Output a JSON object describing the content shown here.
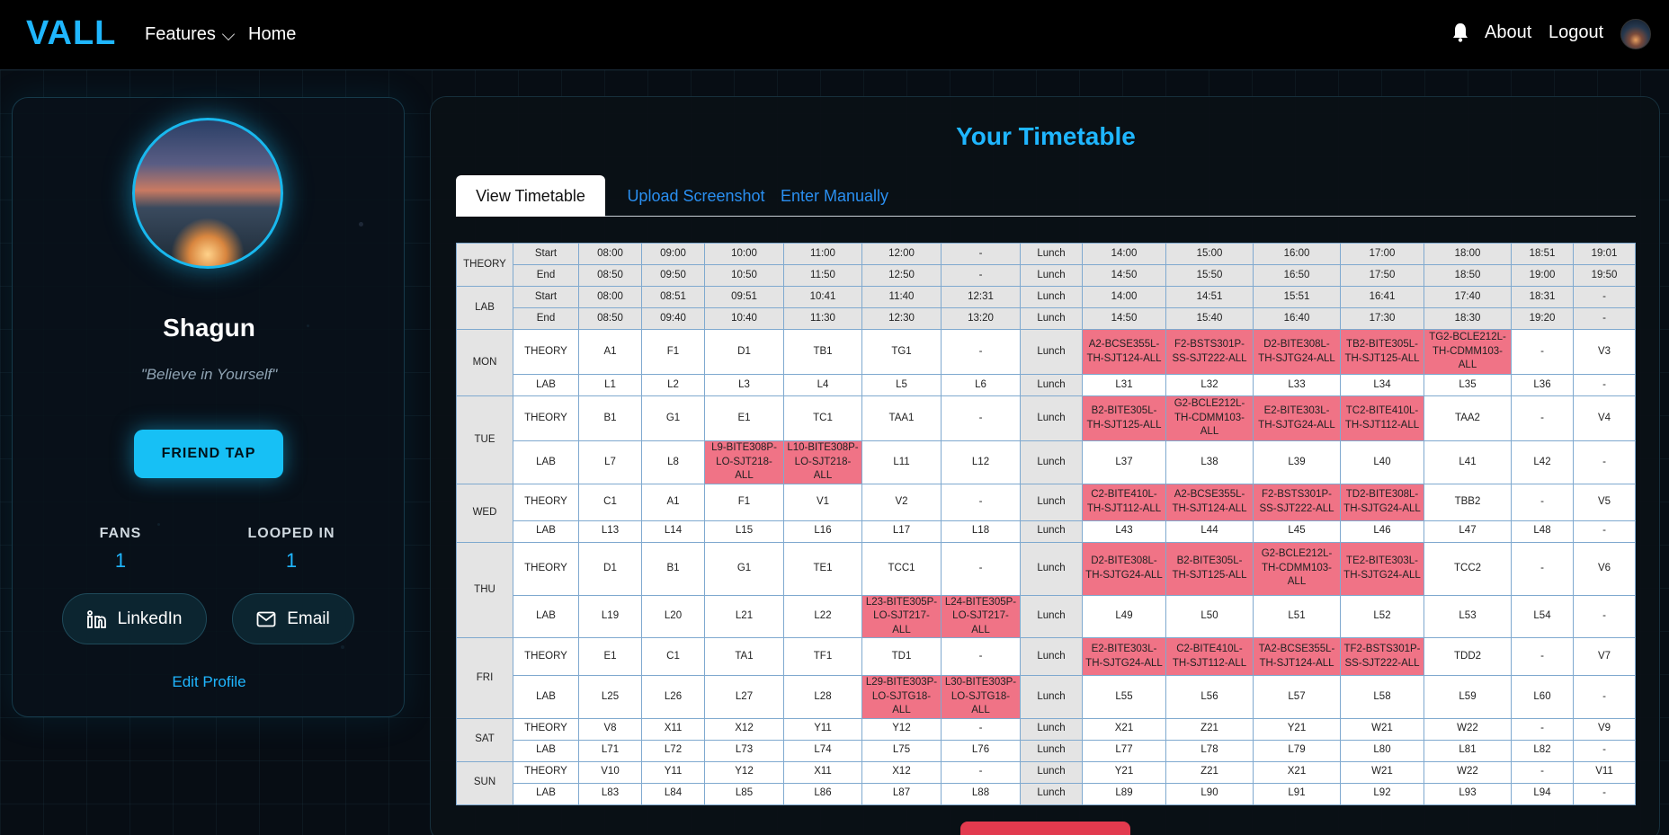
{
  "navbar": {
    "logo": "VALL",
    "features": "Features",
    "home": "Home",
    "about": "About",
    "logout": "Logout"
  },
  "profile": {
    "name": "Shagun",
    "quote": "\"Believe in Yourself\"",
    "friend_tap": "FRIEND TAP",
    "fans_label": "FANS",
    "fans_value": "1",
    "looped_label": "LOOPED IN",
    "looped_value": "1",
    "linkedin": "LinkedIn",
    "email": "Email",
    "edit_profile": "Edit Profile"
  },
  "timetable": {
    "title": "Your Timetable",
    "tabs": [
      "View Timetable",
      "Upload Screenshot",
      "Enter Manually"
    ],
    "header": [
      {
        "group": "THEORY",
        "label": "Start",
        "cells": [
          "08:00",
          "09:00",
          "10:00",
          "11:00",
          "12:00",
          "-",
          "Lunch",
          "14:00",
          "15:00",
          "16:00",
          "17:00",
          "18:00",
          "18:51",
          "19:01"
        ]
      },
      {
        "group": "",
        "label": "End",
        "cells": [
          "08:50",
          "09:50",
          "10:50",
          "11:50",
          "12:50",
          "-",
          "Lunch",
          "14:50",
          "15:50",
          "16:50",
          "17:50",
          "18:50",
          "19:00",
          "19:50"
        ]
      },
      {
        "group": "LAB",
        "label": "Start",
        "cells": [
          "08:00",
          "08:51",
          "09:51",
          "10:41",
          "11:40",
          "12:31",
          "Lunch",
          "14:00",
          "14:51",
          "15:51",
          "16:41",
          "17:40",
          "18:31",
          "-"
        ]
      },
      {
        "group": "",
        "label": "End",
        "cells": [
          "08:50",
          "09:40",
          "10:40",
          "11:30",
          "12:30",
          "13:20",
          "Lunch",
          "14:50",
          "15:40",
          "16:40",
          "17:30",
          "18:30",
          "19:20",
          "-"
        ]
      }
    ],
    "days": [
      {
        "day": "MON",
        "rows": [
          {
            "type": "THEORY",
            "h": "h50",
            "cells": [
              "A1",
              "F1",
              "D1",
              "TB1",
              "TG1",
              "-",
              "Lunch",
              "A2-BCSE355L-TH-SJT124-ALL",
              "F2-BSTS301P-SS-SJT222-ALL",
              "D2-BITE308L-TH-SJTG24-ALL",
              "TB2-BITE305L-TH-SJT125-ALL",
              "TG2-BCLE212L-TH-CDMM103-ALL",
              "-",
              "V3"
            ],
            "sel": [
              7,
              8,
              9,
              10,
              11
            ]
          },
          {
            "type": "LAB",
            "h": "h24",
            "cells": [
              "L1",
              "L2",
              "L3",
              "L4",
              "L5",
              "L6",
              "Lunch",
              "L31",
              "L32",
              "L33",
              "L34",
              "L35",
              "L36",
              "-"
            ],
            "sel": []
          }
        ]
      },
      {
        "day": "TUE",
        "rows": [
          {
            "type": "THEORY",
            "h": "h50",
            "cells": [
              "B1",
              "G1",
              "E1",
              "TC1",
              "TAA1",
              "-",
              "Lunch",
              "B2-BITE305L-TH-SJT125-ALL",
              "G2-BCLE212L-TH-CDMM103-ALL",
              "E2-BITE303L-TH-SJTG24-ALL",
              "TC2-BITE410L-TH-SJT112-ALL",
              "TAA2",
              "-",
              "V4"
            ],
            "sel": [
              7,
              8,
              9,
              10
            ]
          },
          {
            "type": "LAB",
            "h": "h34",
            "cells": [
              "L7",
              "L8",
              "L9-BITE308P-LO-SJT218-ALL",
              "L10-BITE308P-LO-SJT218-ALL",
              "L11",
              "L12",
              "Lunch",
              "L37",
              "L38",
              "L39",
              "L40",
              "L41",
              "L42",
              "-"
            ],
            "sel": [
              2,
              3
            ]
          }
        ]
      },
      {
        "day": "WED",
        "rows": [
          {
            "type": "THEORY",
            "h": "h41",
            "cells": [
              "C1",
              "A1",
              "F1",
              "V1",
              "V2",
              "-",
              "Lunch",
              "C2-BITE410L-TH-SJT112-ALL",
              "A2-BCSE355L-TH-SJT124-ALL",
              "F2-BSTS301P-SS-SJT222-ALL",
              "TD2-BITE308L-TH-SJTG24-ALL",
              "TBB2",
              "-",
              "V5"
            ],
            "sel": [
              7,
              8,
              9,
              10
            ]
          },
          {
            "type": "LAB",
            "h": "h24",
            "cells": [
              "L13",
              "L14",
              "L15",
              "L16",
              "L17",
              "L18",
              "Lunch",
              "L43",
              "L44",
              "L45",
              "L46",
              "L47",
              "L48",
              "-"
            ],
            "sel": []
          }
        ]
      },
      {
        "day": "THU",
        "rows": [
          {
            "type": "THEORY",
            "h": "h59",
            "cells": [
              "D1",
              "B1",
              "G1",
              "TE1",
              "TCC1",
              "-",
              "Lunch",
              "D2-BITE308L-TH-SJTG24-ALL",
              "B2-BITE305L-TH-SJT125-ALL",
              "G2-BCLE212L-TH-CDMM103-ALL",
              "TE2-BITE303L-TH-SJTG24-ALL",
              "TCC2",
              "-",
              "V6"
            ],
            "sel": [
              7,
              8,
              9,
              10
            ]
          },
          {
            "type": "LAB",
            "h": "h42",
            "cells": [
              "L19",
              "L20",
              "L21",
              "L22",
              "L23-BITE305P-LO-SJT217-ALL",
              "L24-BITE305P-LO-SJT217-ALL",
              "Lunch",
              "L49",
              "L50",
              "L51",
              "L52",
              "L53",
              "L54",
              "-"
            ],
            "sel": [
              4,
              5
            ]
          }
        ]
      },
      {
        "day": "FRI",
        "rows": [
          {
            "type": "THEORY",
            "h": "h42",
            "cells": [
              "E1",
              "C1",
              "TA1",
              "TF1",
              "TD1",
              "-",
              "Lunch",
              "E2-BITE303L-TH-SJTG24-ALL",
              "C2-BITE410L-TH-SJT112-ALL",
              "TA2-BCSE355L-TH-SJT124-ALL",
              "TF2-BSTS301P-SS-SJT222-ALL",
              "TDD2",
              "-",
              "V7"
            ],
            "sel": [
              7,
              8,
              9,
              10
            ]
          },
          {
            "type": "LAB",
            "h": "h42",
            "cells": [
              "L25",
              "L26",
              "L27",
              "L28",
              "L29-BITE303P-LO-SJTG18-ALL",
              "L30-BITE303P-LO-SJTG18-ALL",
              "Lunch",
              "L55",
              "L56",
              "L57",
              "L58",
              "L59",
              "L60",
              "-"
            ],
            "sel": [
              4,
              5
            ]
          }
        ]
      },
      {
        "day": "SAT",
        "rows": [
          {
            "type": "THEORY",
            "h": "h24",
            "cells": [
              "V8",
              "X11",
              "X12",
              "Y11",
              "Y12",
              "-",
              "Lunch",
              "X21",
              "Z21",
              "Y21",
              "W21",
              "W22",
              "-",
              "V9"
            ],
            "sel": []
          },
          {
            "type": "LAB",
            "h": "h24",
            "cells": [
              "L71",
              "L72",
              "L73",
              "L74",
              "L75",
              "L76",
              "Lunch",
              "L77",
              "L78",
              "L79",
              "L80",
              "L81",
              "L82",
              "-"
            ],
            "sel": []
          }
        ]
      },
      {
        "day": "SUN",
        "rows": [
          {
            "type": "THEORY",
            "h": "h24",
            "cells": [
              "V10",
              "Y11",
              "Y12",
              "X11",
              "X12",
              "-",
              "Lunch",
              "Y21",
              "Z21",
              "X21",
              "W21",
              "W22",
              "-",
              "V11"
            ],
            "sel": []
          },
          {
            "type": "LAB",
            "h": "h24",
            "cells": [
              "L83",
              "L84",
              "L85",
              "L86",
              "L87",
              "L88",
              "Lunch",
              "L89",
              "L90",
              "L91",
              "L92",
              "L93",
              "L94",
              "-"
            ],
            "sel": []
          }
        ]
      }
    ]
  },
  "colors": {
    "accent": "#1fb6ff",
    "selected_slot": "#f07386",
    "header_bg": "#e4e4e4"
  }
}
